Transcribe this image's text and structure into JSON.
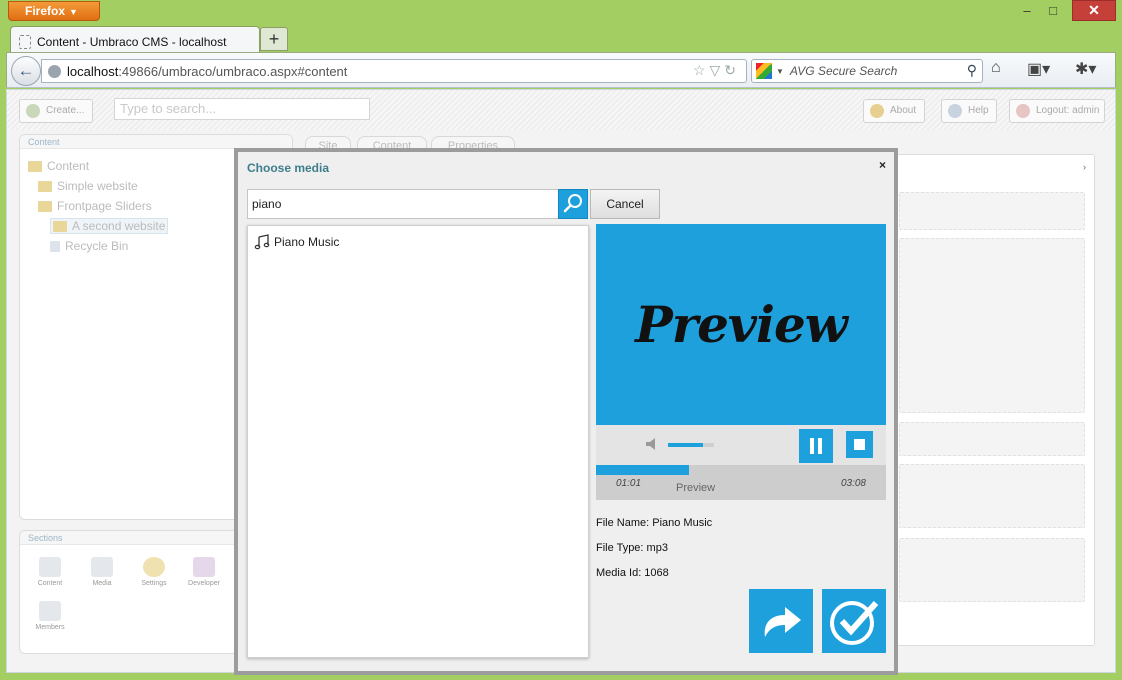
{
  "browser": {
    "app_button": "Firefox",
    "tab_title": "Content - Umbraco CMS - localhost",
    "url_host": "localhost",
    "url_rest": ":49866/umbraco/umbraco.aspx#content",
    "search_placeholder": "AVG Secure Search"
  },
  "umbraco": {
    "create_label": "Create...",
    "search_placeholder": "Type to search...",
    "about_label": "About",
    "help_label": "Help",
    "logout_label": "Logout: admin",
    "content_panel_title": "Content",
    "tree": [
      {
        "label": "Content"
      },
      {
        "label": "Simple website"
      },
      {
        "label": "Frontpage Sliders"
      },
      {
        "label": "A second website"
      },
      {
        "label": "Recycle Bin"
      }
    ],
    "sections_title": "Sections",
    "sections": [
      {
        "label": "Content"
      },
      {
        "label": "Media"
      },
      {
        "label": "Settings"
      },
      {
        "label": "Developer"
      },
      {
        "label": "Members"
      }
    ],
    "editor_tabs": [
      "Site",
      "Content",
      "Properties"
    ]
  },
  "modal": {
    "title": "Choose media",
    "close": "×",
    "search_value": "piano",
    "cancel_label": "Cancel",
    "results": [
      {
        "label": "Piano Music",
        "icon": "music-note-icon"
      }
    ],
    "preview_text": "Preview",
    "player": {
      "current_time": "01:01",
      "duration": "03:08",
      "progress_label": "Preview",
      "progress": 0.32,
      "volume": 0.75
    },
    "file_name_label": "File Name: Piano Music",
    "file_type_label": "File Type: mp3",
    "media_id_label": "Media Id: 1068"
  },
  "colors": {
    "accent": "#1ea0dd",
    "frame": "#a3cf62",
    "modal_title": "#3e7e8c"
  }
}
